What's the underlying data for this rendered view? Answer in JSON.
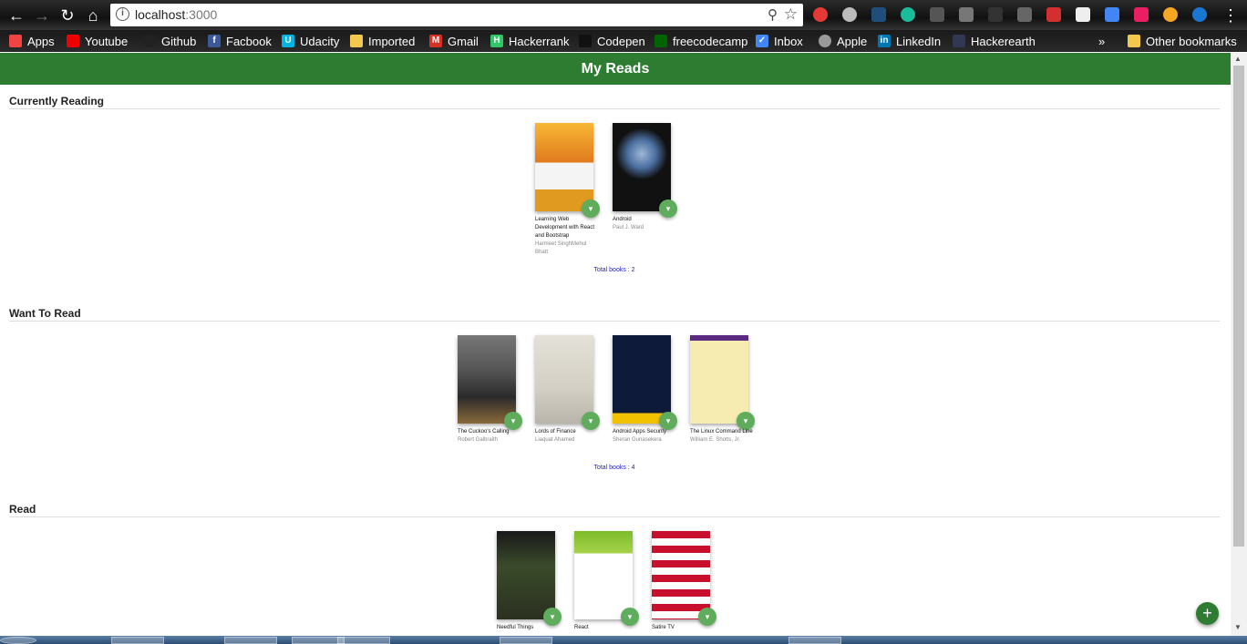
{
  "browser": {
    "url_host": "localhost",
    "url_port": ":3000",
    "bookmarks": [
      {
        "label": "Apps",
        "color": "#e44"
      },
      {
        "label": "Youtube",
        "color": "#e00"
      },
      {
        "label": "Github",
        "color": "#222"
      },
      {
        "label": "Facbook",
        "color": "#3b5998"
      },
      {
        "label": "Udacity",
        "color": "#02b3e4"
      },
      {
        "label": "Imported",
        "color": "#f2c94c"
      },
      {
        "label": "Gmail",
        "color": "#d93025"
      },
      {
        "label": "Hackerrank",
        "color": "#2ec866"
      },
      {
        "label": "Codepen",
        "color": "#111"
      },
      {
        "label": "freecodecamp",
        "color": "#006400"
      },
      {
        "label": "Inbox",
        "color": "#4285f4"
      },
      {
        "label": "Apple",
        "color": "#999"
      },
      {
        "label": "LinkedIn",
        "color": "#0077b5"
      },
      {
        "label": "Hackerearth",
        "color": "#323754"
      }
    ],
    "more": "»",
    "other_bookmarks": "Other bookmarks"
  },
  "app": {
    "title": "My Reads",
    "add_icon": "plus-icon",
    "changer_icon": "caret-down-icon"
  },
  "shelves": [
    {
      "title": "Currently Reading",
      "total": "Total books : 2",
      "books": [
        {
          "title": "Learning Web Development with React and Bootstrap",
          "author": "Harmeet SinghMehul Bhatt",
          "cover_color": "#f4a428"
        },
        {
          "title": "Android",
          "author": "Paul J. Ward",
          "cover_color": "#1a1a1a"
        }
      ]
    },
    {
      "title": "Want To Read",
      "total": "Total books : 4",
      "books": [
        {
          "title": "The Cuckoo's Calling",
          "author": "Robert Galbraith",
          "cover_color": "#3a3a3a"
        },
        {
          "title": "Lords of Finance",
          "author": "Liaquat Ahamed",
          "cover_color": "#d9d6cf"
        },
        {
          "title": "Android Apps Security",
          "author": "Sheran Gunasekera",
          "cover_color": "#0d1a3a"
        },
        {
          "title": "The Linux Command Line",
          "author": "William E. Shotts, Jr.",
          "cover_color": "#f6ebb0"
        }
      ]
    },
    {
      "title": "Read",
      "books": [
        {
          "title": "Needful Things",
          "author": "",
          "cover_color": "#3a4a2a"
        },
        {
          "title": "React",
          "author": "",
          "cover_color": "#ffffff"
        },
        {
          "title": "Satire TV",
          "author": "",
          "cover_color": "#c8102e"
        }
      ]
    }
  ]
}
